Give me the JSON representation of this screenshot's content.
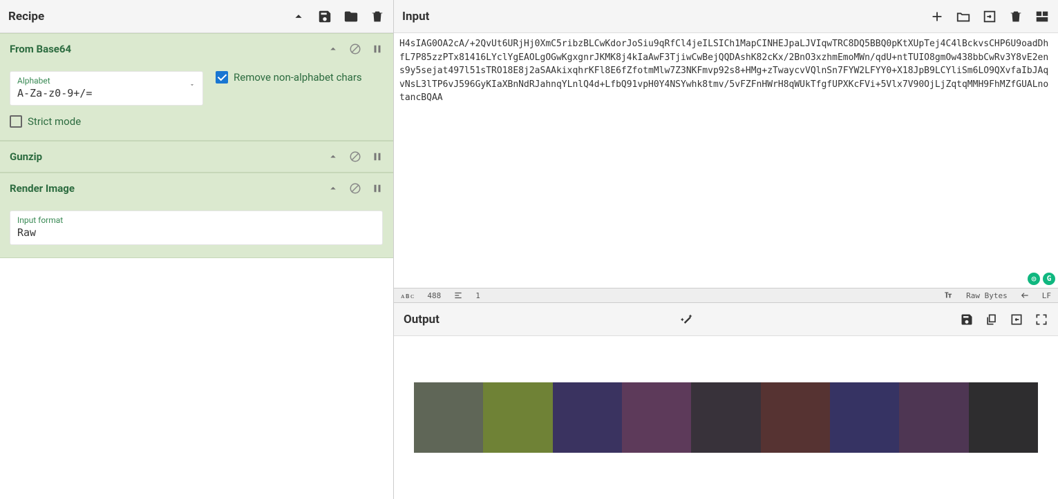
{
  "recipe": {
    "title": "Recipe",
    "ops": [
      {
        "name": "From Base64",
        "expanded": true,
        "fields": {
          "alphabet_label": "Alphabet",
          "alphabet_value": "A-Za-z0-9+/=",
          "remove_non_alpha_label": "Remove non-alphabet chars",
          "remove_non_alpha_checked": true,
          "strict_mode_label": "Strict mode",
          "strict_mode_checked": false
        }
      },
      {
        "name": "Gunzip",
        "expanded": false
      },
      {
        "name": "Render Image",
        "expanded": true,
        "fields": {
          "input_format_label": "Input format",
          "input_format_value": "Raw"
        }
      }
    ]
  },
  "input": {
    "title": "Input",
    "text": "H4sIAG0OA2cA/+2QvUt6URjHj0XmC5ribzBLCwKdorJoSiu9qRfCl4jeILSICh1MapCINHEJpaLJVIqwTRC8DQ5BBQ0pKtXUpTej4C4lBckvsCHP6U9oadDhfL7P85zzPTx81416LYclYgEAOLgOGwKgxgnrJKMK8j4kIaAwF3TjiwCwBejQQDAshK82cKx/2BnO3xzhmEmoMWn/qdU+ntTUIO8gmOw438bbCwRv3Y8vE2ens9y5sejat497l51sTRO18E8j2aSAAkixqhrKFl8E6fZfotmMlw7Z3NKFmvp92s8+HMg+zTwaycvVQlnSn7FYW2LFYY0+X18JpB9LCYliSm6LO9QXvfaIbJAqvNsL3lTP6vJ596GyKIaXBnNdRJahnqYLnlQ4d+LfbQ91vpH0Y4NSYwhk8tmv/5vFZFnHWrH8qWUkTfgfUPXKcFVi+5Vlx7V90OjLjZqtqMMH9FhMZfGUALnotancBQAA"
  },
  "status": {
    "char_count_label": "488",
    "line_count_label": "1",
    "raw_bytes_label": "Raw Bytes",
    "eol_label": "LF"
  },
  "output": {
    "title": "Output",
    "swatches": [
      "#5f6657",
      "#6f8236",
      "#3a3360",
      "#5d3a5a",
      "#38323a",
      "#563332",
      "#363363",
      "#4e3653",
      "#2e2d2f"
    ]
  }
}
